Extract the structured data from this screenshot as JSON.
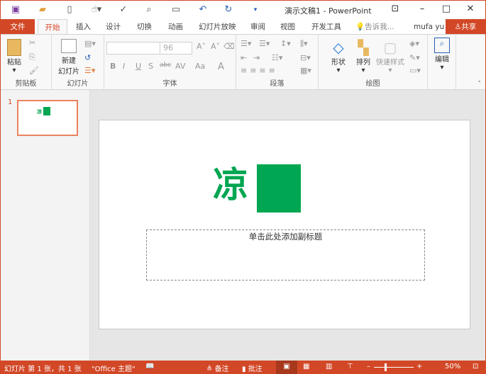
{
  "window": {
    "title": "演示文稿1 - PowerPoint",
    "user": "mufa yu",
    "share": "共享"
  },
  "tabs": [
    "文件",
    "开始",
    "插入",
    "设计",
    "切换",
    "动画",
    "幻灯片放映",
    "审阅",
    "视图",
    "开发工具"
  ],
  "tell_me": "告诉我...",
  "ribbon": {
    "clipboard": {
      "paste": "粘贴",
      "label": "剪贴板"
    },
    "slides": {
      "new_slide": "新建",
      "new_slide2": "幻灯片",
      "label": "幻灯片"
    },
    "font": {
      "font_name": "",
      "font_size": "96",
      "label": "字体",
      "bold": "B",
      "italic": "I",
      "underline": "U",
      "shadow": "S",
      "strike": "abc",
      "spacing": "AV",
      "case": "Aa",
      "color": "A"
    },
    "paragraph": {
      "label": "段落"
    },
    "drawing": {
      "shape": "形状",
      "arrange": "排列",
      "quick_style": "快速样式",
      "label": "绘图"
    },
    "editing": {
      "edit": "编辑"
    }
  },
  "thumbnails": [
    {
      "number": "1",
      "text": "凉"
    }
  ],
  "slide": {
    "title": "凉",
    "subtitle_placeholder": "单击此处添加副标题",
    "accent": "#00a651"
  },
  "status": {
    "slide_info": "幻灯片 第 1 张，共 1 张",
    "theme": "\"Office 主题\"",
    "notes": "备注",
    "comments": "批注",
    "zoom": "50%"
  },
  "colors": {
    "brand": "#d24726"
  }
}
